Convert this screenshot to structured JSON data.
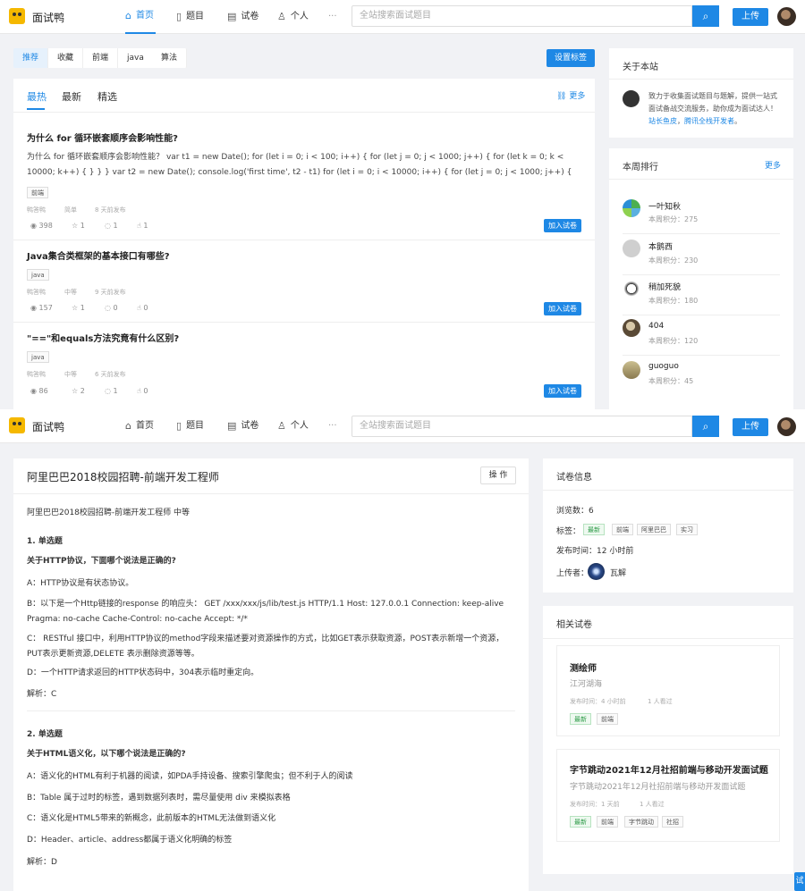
{
  "header": {
    "brand": "面试鸭",
    "nav": [
      {
        "icon": "home-icon",
        "glyph": "⌂",
        "label": "首页"
      },
      {
        "icon": "file-icon",
        "glyph": "▯",
        "label": "题目"
      },
      {
        "icon": "paper-icon",
        "glyph": "▤",
        "label": "试卷"
      },
      {
        "icon": "user-icon",
        "glyph": "♙",
        "label": "个人"
      }
    ],
    "more": "···",
    "search_placeholder": "全站搜索面试题目",
    "search_glyph": "⌕",
    "upload": "上传"
  },
  "home": {
    "tags": [
      "推荐",
      "收藏",
      "前端",
      "java",
      "算法"
    ],
    "set_tags": "设置标签",
    "subtabs": [
      "最热",
      "最新",
      "精选"
    ],
    "more": "更多",
    "questions": [
      {
        "title": "为什么 for 循环嵌套顺序会影响性能?",
        "body": "为什么 for 循环嵌套顺序会影响性能？ var t1 = new Date(); for (let i = 0; i < 100; i++) { for (let j = 0; j < 1000; j++) { for (let k = 0; k < 10000; k++) { } } } var t2 = new Date(); console.log('first time', t2 - t1) for (let i = 0; i < 10000; i++) { for (let j = 0; j < 1000; j++) { for (let k = 0; k < 10...",
        "tags": [
          "前端"
        ],
        "author": "鸭答鸭",
        "level": "简单",
        "time": "8 天前发布",
        "views": "398",
        "stars": "1",
        "comments": "1",
        "likes": "1",
        "add": "加入试卷"
      },
      {
        "title": "Java集合类框架的基本接口有哪些?",
        "tags": [
          "java"
        ],
        "author": "鸭答鸭",
        "level": "中等",
        "time": "9 天前发布",
        "views": "157",
        "stars": "1",
        "comments": "0",
        "likes": "0",
        "add": "加入试卷"
      },
      {
        "title": "\"==\"和equals方法究竟有什么区别?",
        "tags": [
          "java"
        ],
        "author": "鸭答鸭",
        "level": "中等",
        "time": "6 天前发布",
        "views": "86",
        "stars": "2",
        "comments": "1",
        "likes": "0",
        "add": "加入试卷"
      }
    ],
    "about": {
      "title": "关于本站",
      "text_before": "致力于收集面试题目与题解，提供一站式面试备战交流服务，助你成为面试达人！",
      "link1": "站长鱼皮",
      "sep": "，",
      "link2": "腾讯全栈开发者",
      "end": "。"
    },
    "ranking": {
      "title": "本周排行",
      "more": "更多",
      "items": [
        {
          "name": "一叶知秋",
          "score": "本周积分：275",
          "color": "#5ab0e0"
        },
        {
          "name": "本鹅西",
          "score": "本周积分：230",
          "color": "#cfcfcf"
        },
        {
          "name": "稍加死貌",
          "score": "本周积分：180",
          "color": "#444444"
        },
        {
          "name": "404",
          "score": "本周积分：120",
          "color": "#7a6a52"
        },
        {
          "name": "guoguo",
          "score": "本周积分：45",
          "color": "#9a8a60"
        }
      ]
    }
  },
  "paper": {
    "title": "阿里巴巴2018校园招聘-前端开发工程师",
    "action": "操 作",
    "subtitle": "阿里巴巴2018校园招聘-前端开发工程师 中等",
    "q1_heading": "1. 单选题",
    "q1_question": "关于HTTP协议，下面哪个说法是正确的?",
    "q1_options": [
      "A：HTTP协议是有状态协议。",
      "B：以下是一个Http链接的response 的响应头： GET /xxx/xxx/js/lib/test.js HTTP/1.1 Host: 127.0.0.1 Connection: keep-alive Pragma: no-cache Cache-Control: no-cache Accept: */*",
      "C： RESTful 接口中，利用HTTP协议的method字段来描述要对资源操作的方式，比如GET表示获取资源，POST表示新增一个资源，PUT表示更新资源,DELETE 表示删除资源等等。",
      "D：一个HTTP请求返回的HTTP状态码中，304表示临时重定向。"
    ],
    "q1_analysis": "解析：C",
    "q2_heading": "2. 单选题",
    "q2_question": "关于HTML语义化，以下哪个说法是正确的?",
    "q2_options": [
      "A：语义化的HTML有利于机器的阅读，如PDA手持设备、搜索引擎爬虫；但不利于人的阅读",
      "B：Table 属于过时的标签，遇到数据列表时，需尽量使用 div 来模拟表格",
      "C：语义化是HTML5带来的新概念，此前版本的HTML无法做到语义化",
      "D：Header、article、address都属于语义化明确的标签"
    ],
    "q2_analysis": "解析：D",
    "info": {
      "title": "试卷信息",
      "views_label": "浏览数：",
      "views": "6",
      "tags_label": "标签：",
      "tags": [
        "最新",
        "前端",
        "阿里巴巴",
        "实习"
      ],
      "time_label": "发布时间：",
      "time": "12 小时前",
      "uploader_label": "上传者：",
      "uploader": "瓦解"
    },
    "related": {
      "title": "相关试卷",
      "items": [
        {
          "name": "测绘师",
          "desc": "江河湖海",
          "time": "发布时间：4 小时前",
          "viewers": "1 人看过",
          "tags": [
            "最新",
            "前端"
          ]
        },
        {
          "name": "字节跳动2021年12月社招前端与移动开发面试题",
          "desc": "字节跳动2021年12月社招前端与移动开发面试题",
          "time": "发布时间：1 天前",
          "viewers": "1 人看过",
          "tags": [
            "最新",
            "前端",
            "字节跳动",
            "社招"
          ]
        }
      ]
    },
    "float_btn": "试"
  }
}
